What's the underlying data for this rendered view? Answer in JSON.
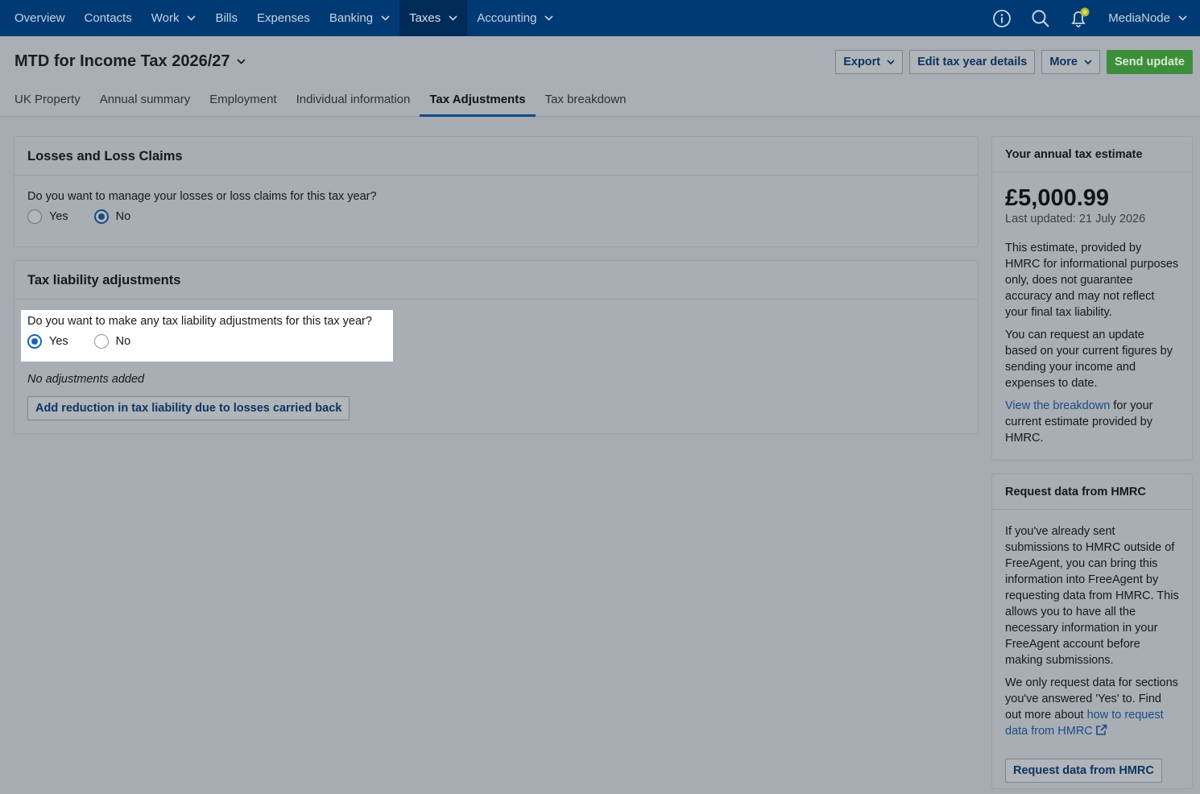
{
  "nav": {
    "items": [
      {
        "label": "Overview",
        "dropdown": false,
        "active": false
      },
      {
        "label": "Contacts",
        "dropdown": false,
        "active": false
      },
      {
        "label": "Work",
        "dropdown": true,
        "active": false
      },
      {
        "label": "Bills",
        "dropdown": false,
        "active": false
      },
      {
        "label": "Expenses",
        "dropdown": false,
        "active": false
      },
      {
        "label": "Banking",
        "dropdown": true,
        "active": false
      },
      {
        "label": "Taxes",
        "dropdown": true,
        "active": true
      },
      {
        "label": "Accounting",
        "dropdown": true,
        "active": false
      }
    ],
    "icons": [
      "info-icon",
      "search-icon",
      "notification-bell-icon"
    ],
    "account_label": "MediaNode"
  },
  "header": {
    "title": "MTD for Income Tax 2026/27",
    "buttons": {
      "export": "Export",
      "edit": "Edit tax year details",
      "more": "More",
      "send": "Send update"
    }
  },
  "tabs": [
    {
      "label": "UK Property",
      "active": false
    },
    {
      "label": "Annual summary",
      "active": false
    },
    {
      "label": "Employment",
      "active": false
    },
    {
      "label": "Individual information",
      "active": false
    },
    {
      "label": "Tax Adjustments",
      "active": true
    },
    {
      "label": "Tax breakdown",
      "active": false
    }
  ],
  "losses": {
    "title": "Losses and Loss Claims",
    "question": "Do you want to manage your losses or loss claims for this tax year?",
    "yes": "Yes",
    "no": "No",
    "selected": "No"
  },
  "liability": {
    "title": "Tax liability adjustments",
    "question": "Do you want to make any tax liability adjustments for this tax year?",
    "yes": "Yes",
    "no": "No",
    "selected": "Yes",
    "empty_text": "No adjustments added",
    "add_button": "Add reduction in tax liability due to losses carried back"
  },
  "estimate": {
    "title": "Your annual tax estimate",
    "amount": "£5,000.99",
    "updated": "Last updated: 21 July 2026",
    "p1": "This estimate, provided by HMRC for informational purposes only, does not guarantee accuracy and may not reflect your final tax liability.",
    "p2": "You can request an update based on your current figures by sending your income and expenses to date.",
    "p3_link": "View the breakdown",
    "p3_rest": " for your current estimate provided by HMRC."
  },
  "hmrc": {
    "title": "Request data from HMRC",
    "p1": "If you've already sent submissions to HMRC outside of FreeAgent, you can bring this information into FreeAgent by requesting data from HMRC. This allows you to have all the necessary information in your FreeAgent account before making submissions.",
    "p2_text": "We only request data for sections you've answered 'Yes' to. Find out more about ",
    "p2_link": "how to request data from HMRC",
    "button": "Request data from HMRC"
  },
  "colors": {
    "nav_bg": "#003a74",
    "primary_green": "#3d8e3a",
    "link_blue": "#1a4c86"
  }
}
